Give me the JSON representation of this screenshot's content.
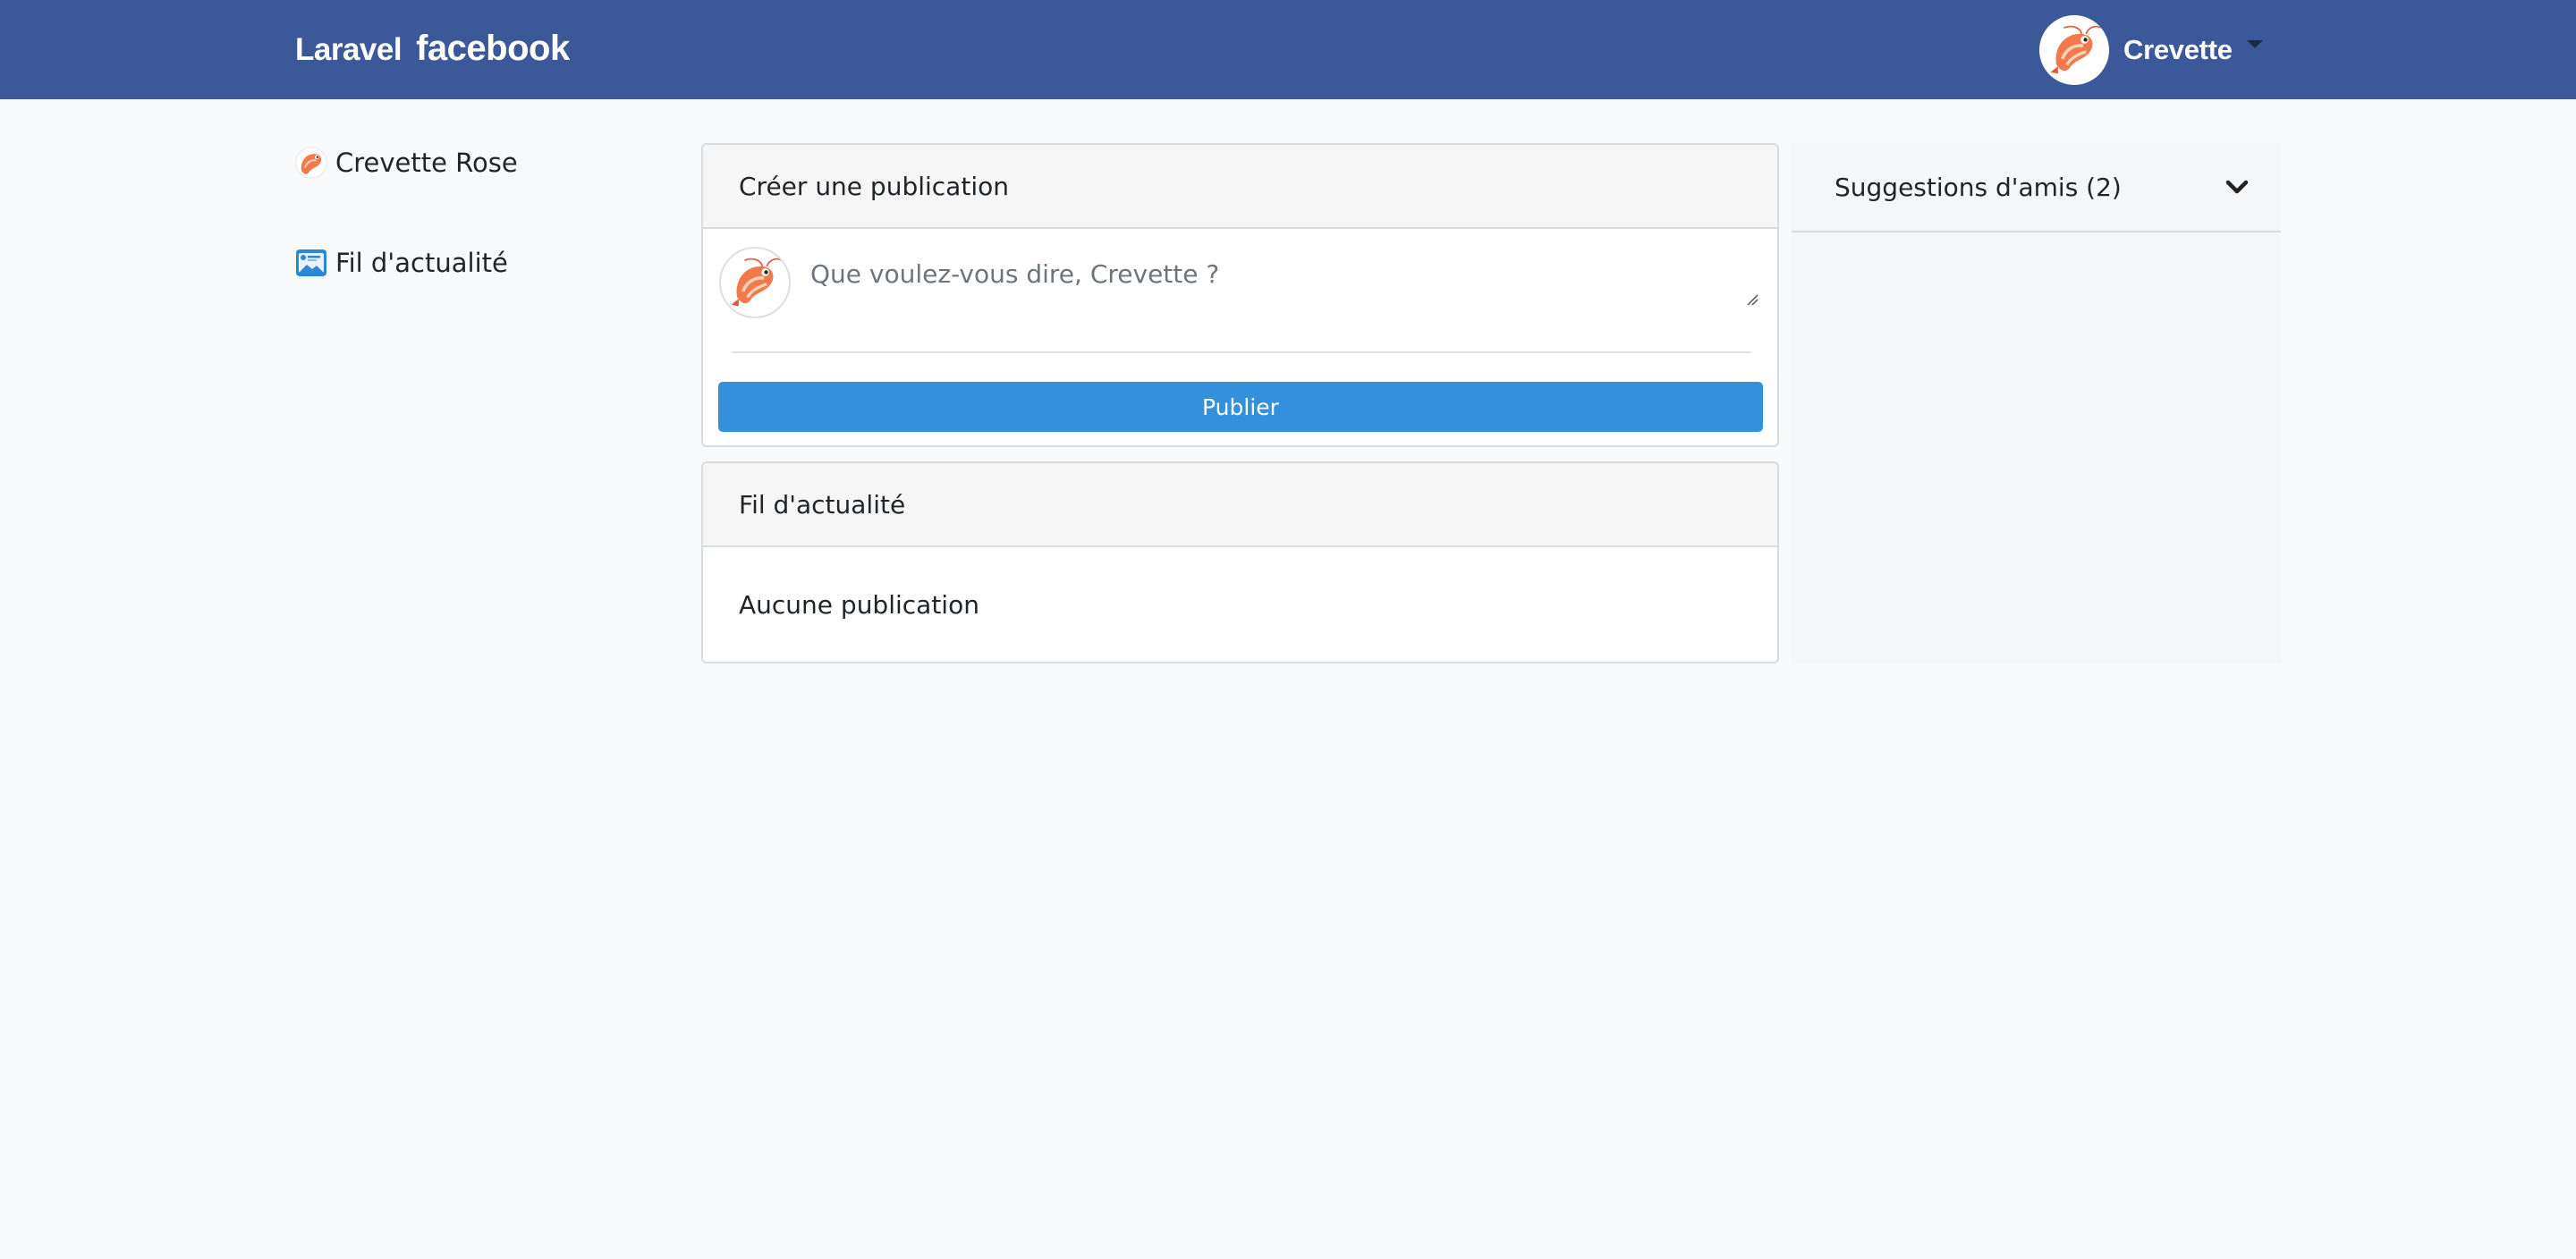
{
  "navbar": {
    "brand_prefix": "Laravel",
    "brand_name": "facebook",
    "username": "Crevette",
    "avatar_icon": "shrimp-avatar-icon",
    "background": "#3b5998"
  },
  "sidebar": {
    "items": [
      {
        "label": "Crevette Rose",
        "icon": "shrimp-avatar-icon"
      },
      {
        "label": "Fil d'actualité",
        "icon": "news-feed-icon"
      }
    ]
  },
  "composer": {
    "title": "Créer une publication",
    "placeholder": "Que voulez-vous dire, Crevette ?",
    "value": "",
    "submit_label": "Publier",
    "submit_color": "#3490dc"
  },
  "feed": {
    "title": "Fil d'actualité",
    "empty_text": "Aucune publication"
  },
  "suggestions": {
    "title": "Suggestions d'amis (2)",
    "toggle_icon": "chevron-down-icon"
  }
}
